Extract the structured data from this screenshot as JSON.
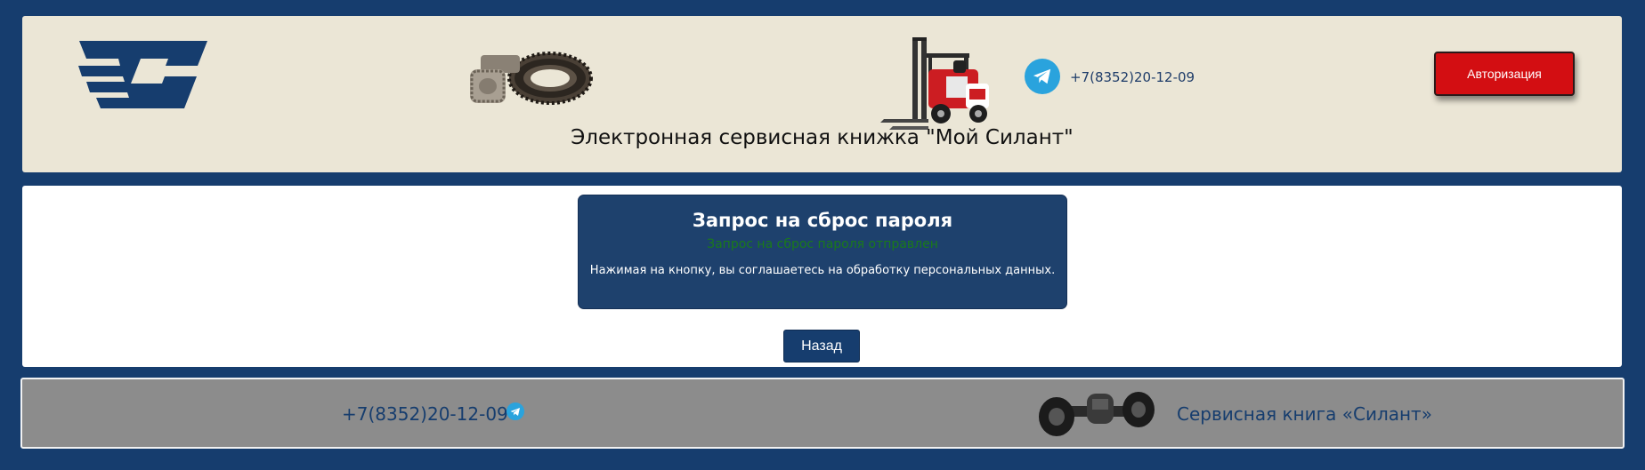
{
  "colors": {
    "page_background": "#163d6e",
    "header_background": "#ebe6d6",
    "card_background": "#1e416d",
    "status_success": "#1a7a1a",
    "auth_button": "#d30e12",
    "footer_background": "#8c8c8c",
    "telegram": "#2aa3dd"
  },
  "header": {
    "logo_icon": "silant-logo-icon",
    "gear_image_icon": "bevel-gear-image",
    "forklift_image_icon": "forklift-image",
    "telegram_icon": "telegram-icon",
    "phone": "+7(8352)20-12-09",
    "auth_button_label": "Авторизация",
    "title": "Электронная сервисная книжка \"Мой Силант\""
  },
  "reset_card": {
    "title": "Запрос на сброс пароля",
    "status": "Запрос на сброс пароля отправлен",
    "consent": "Нажимая на кнопку, вы соглашаетесь на обработку персональных данных."
  },
  "back_button_label": "Назад",
  "footer": {
    "phone": "+7(8352)20-12-09",
    "telegram_icon": "telegram-icon",
    "axle_image_icon": "axle-image",
    "brand": "Сервисная книга «Силант»"
  }
}
